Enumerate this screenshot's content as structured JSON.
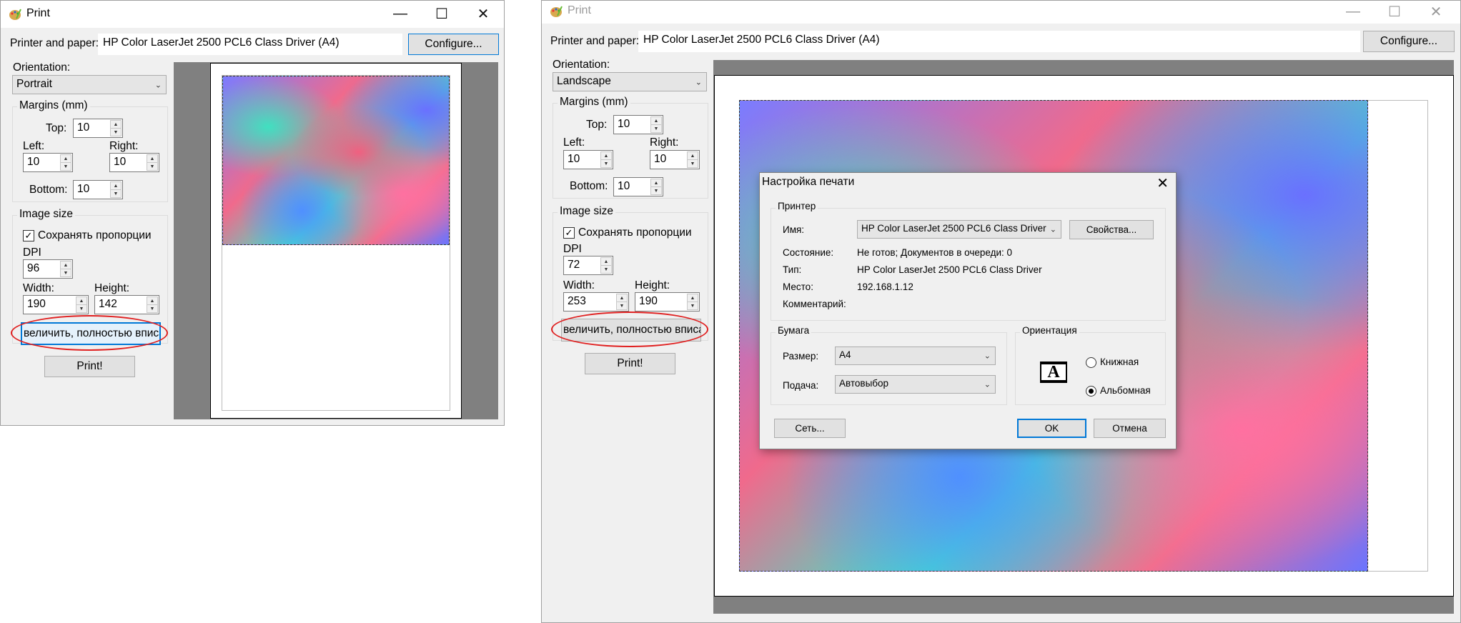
{
  "left_window": {
    "title": "Print",
    "printer_label": "Printer and paper:",
    "printer_value": "HP Color LaserJet 2500 PCL6 Class Driver (A4)",
    "configure_label": "Configure...",
    "orientation_label": "Orientation:",
    "orientation_value": "Portrait",
    "margins_title": "Margins (mm)",
    "top_label": "Top:",
    "top_value": "10",
    "left_label": "Left:",
    "left_value": "10",
    "right_label": "Right:",
    "right_value": "10",
    "bottom_label": "Bottom:",
    "bottom_value": "10",
    "image_size_title": "Image size",
    "keep_ratio_label": "Сохранять пропорции",
    "dpi_label": "DPI",
    "dpi_value": "96",
    "width_label": "Width:",
    "width_value": "190",
    "height_label": "Height:",
    "height_value": "142",
    "fit_button_label": "величить, полностью вписа",
    "print_label": "Print!"
  },
  "right_window": {
    "title": "Print",
    "printer_label": "Printer and paper:",
    "printer_value": "HP Color LaserJet 2500 PCL6 Class Driver (A4)",
    "configure_label": "Configure...",
    "orientation_label": "Orientation:",
    "orientation_value": "Landscape",
    "margins_title": "Margins (mm)",
    "top_label": "Top:",
    "top_value": "10",
    "left_label": "Left:",
    "left_value": "10",
    "right_label": "Right:",
    "right_value": "10",
    "bottom_label": "Bottom:",
    "bottom_value": "10",
    "image_size_title": "Image size",
    "keep_ratio_label": "Сохранять пропорции",
    "dpi_label": "DPI",
    "dpi_value": "72",
    "width_label": "Width:",
    "width_value": "253",
    "height_label": "Height:",
    "height_value": "190",
    "fit_button_label": "величить, полностью вписа",
    "print_label": "Print!"
  },
  "print_setup_dialog": {
    "title": "Настройка печати",
    "printer_group": "Принтер",
    "name_label": "Имя:",
    "name_value": "HP Color LaserJet 2500 PCL6 Class Driver",
    "properties_label": "Свойства...",
    "status_label": "Состояние:",
    "status_value": "Не готов; Документов в очереди: 0",
    "type_label": "Тип:",
    "type_value": "HP Color LaserJet 2500 PCL6 Class Driver",
    "where_label": "Место:",
    "where_value": "192.168.1.12",
    "comment_label": "Комментарий:",
    "paper_group": "Бумага",
    "size_label": "Размер:",
    "size_value": "A4",
    "source_label": "Подача:",
    "source_value": "Автовыбор",
    "orientation_group": "Ориентация",
    "portrait_label": "Книжная",
    "landscape_label": "Альбомная",
    "network_label": "Сеть...",
    "ok_label": "OK",
    "cancel_label": "Отмена"
  },
  "icons": [
    "app-palette-icon",
    "minimize-icon",
    "maximize-icon",
    "close-icon",
    "chevron-down-icon",
    "spin-up-icon",
    "spin-down-icon",
    "checkmark-icon",
    "orientation-a-icon"
  ],
  "colors": {
    "accent": "#0078d7",
    "annotation": "#e02020",
    "preview_bg": "#808080"
  }
}
